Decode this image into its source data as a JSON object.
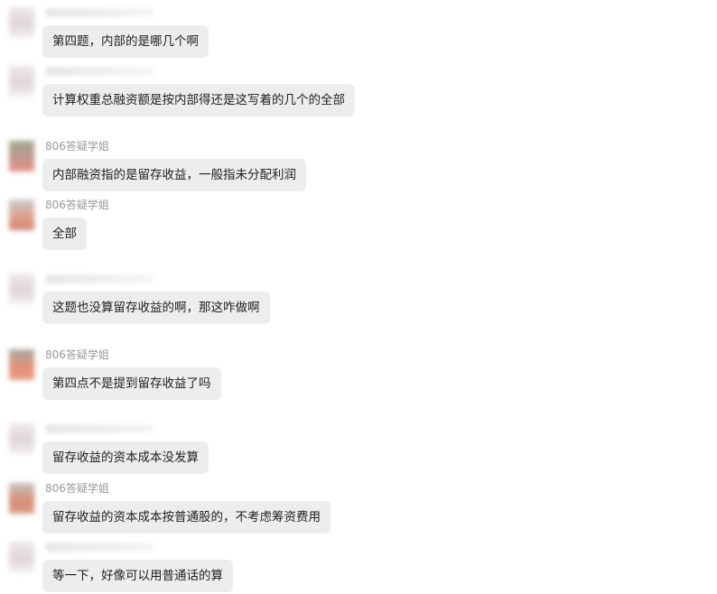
{
  "messages": [
    {
      "sender": "",
      "text": "第四题，内部的是哪几个啊"
    },
    {
      "sender": "",
      "text": "计算权重总融资额是按内部得还是这写着的几个的全部"
    },
    {
      "sender": "806答疑学姐",
      "text": "内部融资指的是留存收益，一般指未分配利润"
    },
    {
      "sender": "806答疑学姐",
      "text": "全部"
    },
    {
      "sender": "",
      "text": "这题也没算留存收益的啊，那这咋做啊"
    },
    {
      "sender": "806答疑学姐",
      "text": "第四点不是提到留存收益了吗"
    },
    {
      "sender": "",
      "text": "留存收益的资本成本没发算"
    },
    {
      "sender": "806答疑学姐",
      "text": "留存收益的资本成本按普通股的，不考虑筹资费用"
    },
    {
      "sender": "",
      "text": "等一下，好像可以用普通话的算"
    }
  ]
}
